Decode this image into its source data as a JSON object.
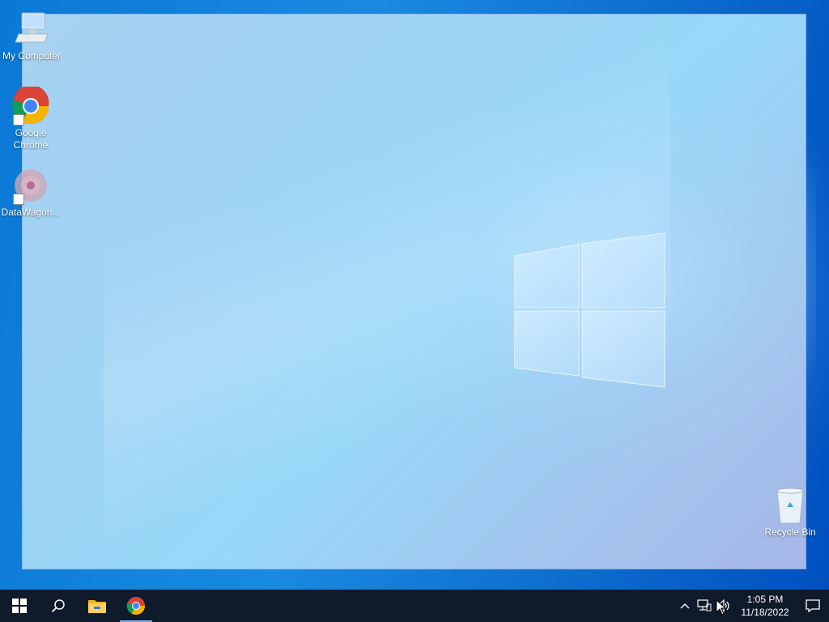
{
  "desktop": {
    "icons": [
      {
        "label": "My Computer"
      },
      {
        "label": "Google Chrome"
      },
      {
        "label": "DataWagon..."
      },
      {
        "label": "Recycle Bin"
      }
    ]
  },
  "taskbar": {
    "start": "start-icon",
    "search": "search-icon",
    "pinned": [
      "file-explorer-icon",
      "chrome-icon"
    ],
    "active_app": "chrome"
  },
  "tray": {
    "time": "1:05 PM",
    "date": "11/18/2022"
  },
  "colors": {
    "taskbar_bg": "#0f1a2b",
    "desktop_blue": "#0a78d6",
    "accent": "#7ab5f0"
  }
}
